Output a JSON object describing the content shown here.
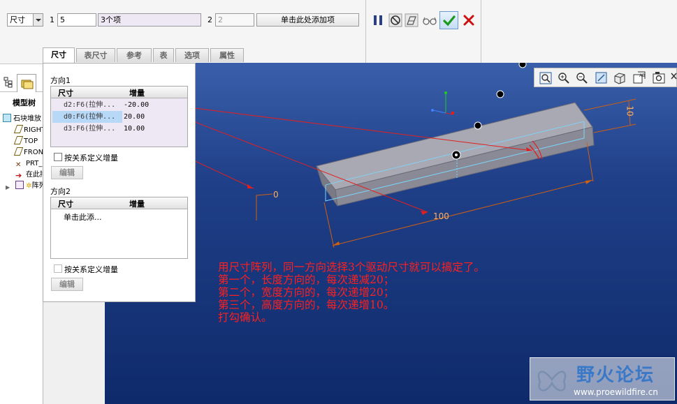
{
  "dashboard": {
    "type_select": "尺寸",
    "dir1_num": "1",
    "dir1_count": "5",
    "dir1_items": "3个项",
    "dir2_num": "2",
    "dir2_count": "2",
    "dir2_add": "单击此处添加项"
  },
  "tabs": [
    {
      "label": "尺寸",
      "active": true
    },
    {
      "label": "表尺寸",
      "active": false
    },
    {
      "label": "参考",
      "active": false
    },
    {
      "label": "表",
      "active": false
    },
    {
      "label": "选项",
      "active": false
    },
    {
      "label": "属性",
      "active": false
    }
  ],
  "tree": {
    "tab_label": "模型树",
    "items": [
      {
        "label": "石块堆放",
        "icon": "part-icon"
      },
      {
        "label": "RIGHT",
        "icon": "datum-plane-icon"
      },
      {
        "label": "TOP",
        "icon": "datum-plane-icon"
      },
      {
        "label": "FRONT",
        "icon": "datum-plane-icon"
      },
      {
        "label": "PRT_CSYS",
        "icon": "csys-icon"
      },
      {
        "label": "在此插入",
        "icon": "insert-arrow-icon"
      },
      {
        "label": "阵列",
        "icon": "pattern-icon"
      }
    ]
  },
  "panel": {
    "dir1_title": "方向1",
    "col_dim": "尺寸",
    "col_inc": "增量",
    "dir1_rows": [
      {
        "dim": "d2:F6(拉伸...",
        "inc": "-20.00",
        "selected": false
      },
      {
        "dim": "d0:F6(拉伸...",
        "inc": "20.00",
        "selected": true
      },
      {
        "dim": "d3:F6(拉伸...",
        "inc": "10.00",
        "selected": false
      }
    ],
    "dir1_relation": "按关系定义增量",
    "edit": "编辑",
    "dir2_title": "方向2",
    "dir2_placeholder": "单击此添...",
    "dir2_relation": "按关系定义增量"
  },
  "model": {
    "dim_length": "100",
    "dim_width": "0",
    "dim_height": "10"
  },
  "annotation": {
    "lines": [
      "用尺寸阵列，同一方向选择3个驱动尺寸就可以搞定了。",
      "第一个，长度方向的，每次递减20；",
      "第二个，宽度方向的，每次递增20；",
      "第三个，高度方向的，每次递增10。",
      "打勾确认。"
    ]
  },
  "watermark": {
    "name": "野火论坛",
    "url": "www.proewildfire.cn"
  },
  "colors": {
    "annotation": "#ff2020",
    "viewport_top": "#3a5faa",
    "viewport_bottom": "#0e2a6a",
    "confirm": "#1a9a1a",
    "cancel": "#cc1010"
  }
}
